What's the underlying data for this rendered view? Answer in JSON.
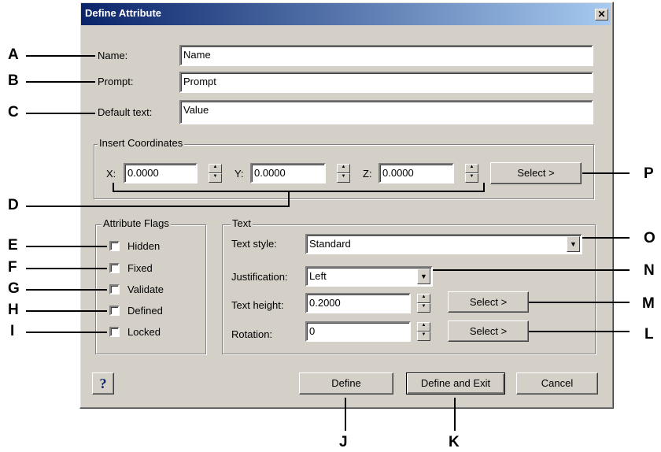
{
  "window": {
    "title": "Define Attribute",
    "close_glyph": "✕"
  },
  "fields": {
    "name": {
      "label": "Name:",
      "value": "Name"
    },
    "prompt": {
      "label": "Prompt:",
      "value": "Prompt"
    },
    "default_text": {
      "label": "Default text:",
      "value": "Value"
    }
  },
  "insert_coordinates": {
    "title": "Insert Coordinates",
    "x_label": "X:",
    "x_value": "0.0000",
    "y_label": "Y:",
    "y_value": "0.0000",
    "z_label": "Z:",
    "z_value": "0.0000",
    "select_label": "Select >"
  },
  "attribute_flags": {
    "title": "Attribute Flags",
    "items": [
      {
        "label": "Hidden",
        "checked": false
      },
      {
        "label": "Fixed",
        "checked": false
      },
      {
        "label": "Validate",
        "checked": false
      },
      {
        "label": "Defined",
        "checked": false
      },
      {
        "label": "Locked",
        "checked": false
      }
    ]
  },
  "text": {
    "title": "Text",
    "style_label": "Text style:",
    "style_value": "Standard",
    "justification_label": "Justification:",
    "justification_value": "Left",
    "height_label": "Text height:",
    "height_value": "0.2000",
    "height_select": "Select >",
    "rotation_label": "Rotation:",
    "rotation_value": "0",
    "rotation_select": "Select >"
  },
  "footer": {
    "help_glyph": "?",
    "define_label": "Define",
    "define_exit_label": "Define and Exit",
    "cancel_label": "Cancel"
  },
  "callouts": {
    "A": "A",
    "B": "B",
    "C": "C",
    "D": "D",
    "E": "E",
    "F": "F",
    "G": "G",
    "H": "H",
    "I": "I",
    "J": "J",
    "K": "K",
    "L": "L",
    "M": "M",
    "N": "N",
    "O": "O",
    "P": "P"
  },
  "colors": {
    "dialog_bg": "#d4d0c8",
    "titlebar_start": "#0a246a",
    "titlebar_end": "#a6caf0"
  }
}
